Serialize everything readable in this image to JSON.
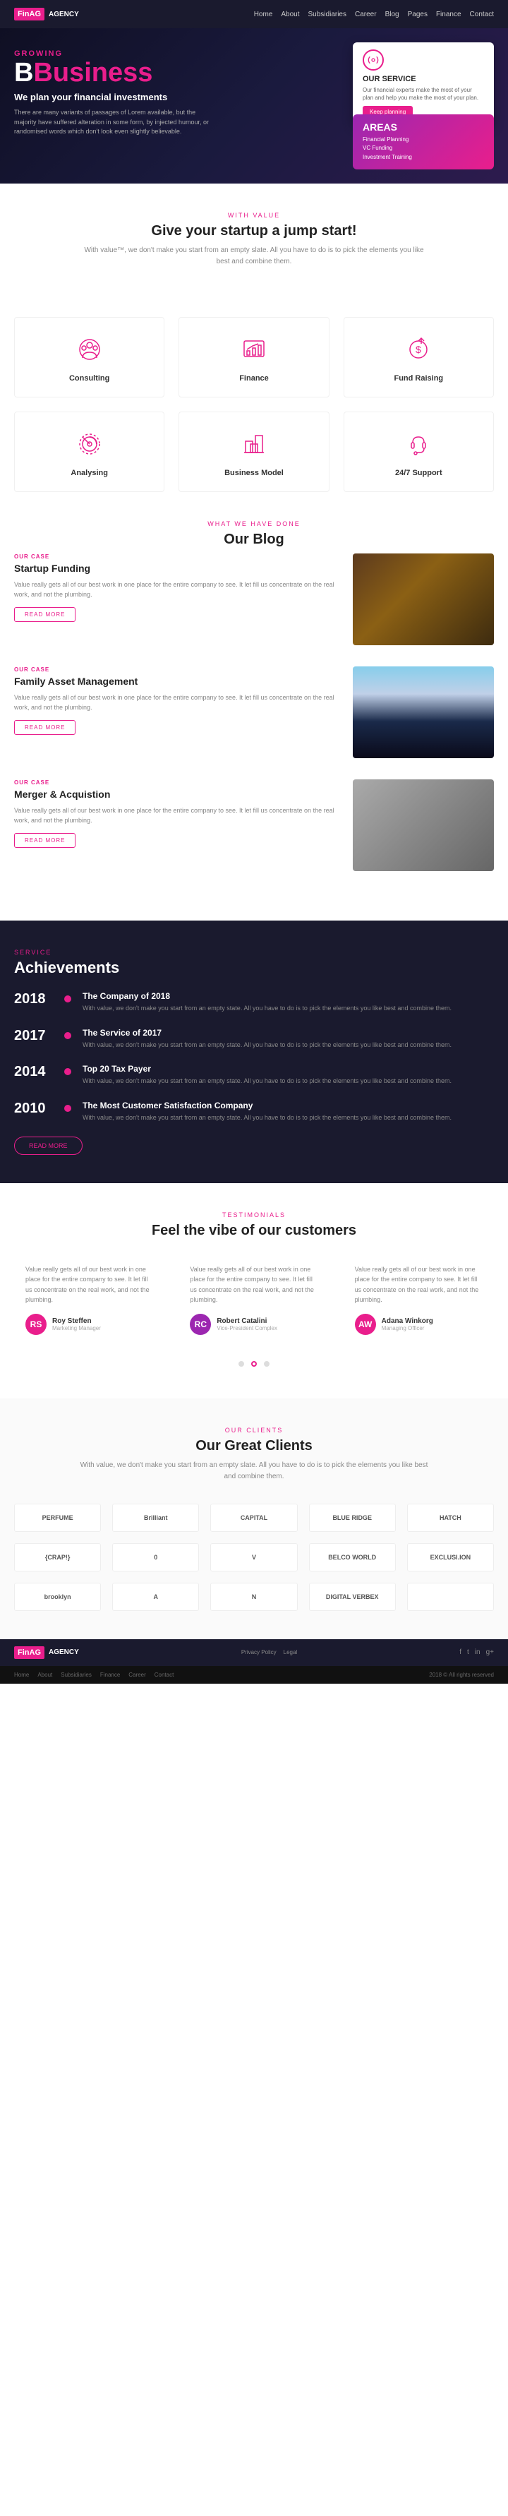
{
  "nav": {
    "logo": "FinAG",
    "logo_sub": "AGENCY",
    "links": [
      "Home",
      "About",
      "Subsidiaries",
      "Career",
      "Blog",
      "Pages",
      "Finance",
      "Contact"
    ]
  },
  "hero": {
    "label": "GROWING",
    "title": "Business",
    "title_color": "Business",
    "subtitle": "We plan your financial investments",
    "description": "There are many variants of passages of Lorem available, but the majority have suffered alteration in some form, by injected humour, or randomised words which don't look even slightly believable.",
    "service_card": {
      "title": "OUR SERVICE",
      "description": "Our financial experts make the most of your plan and help you make the most of your plan.",
      "button": "Keep planning"
    },
    "areas": {
      "title": "AREAS",
      "items": [
        "Financial Planning",
        "VC Funding",
        "Investment Training"
      ]
    }
  },
  "startup_section": {
    "label": "WITH VALUE",
    "title": "Give your startup a jump start!",
    "subtitle": "With value™, we don't make you start from an empty slate. All you have to do is to pick the elements you like best and combine them."
  },
  "services": [
    {
      "name": "Consulting",
      "icon": "globe-people"
    },
    {
      "name": "Finance",
      "icon": "chart-bar"
    },
    {
      "name": "Fund Raising",
      "icon": "coin-up"
    },
    {
      "name": "Analysing",
      "icon": "gear-chart"
    },
    {
      "name": "Business Model",
      "icon": "building-chart"
    },
    {
      "name": "24/7 Support",
      "icon": "support-bag"
    }
  ],
  "blog": {
    "label": "WHAT WE HAVE DONE",
    "title": "Our Blog",
    "items": [
      {
        "category": "OUR CASE",
        "title": "Startup Funding",
        "text": "Value really gets all of our best work in one place for the entire company to see. It let fill us concentrate on the real work, and not the plumbing.",
        "button": "READ MORE"
      },
      {
        "category": "OUR CASE",
        "title": "Family Asset Management",
        "text": "Value really gets all of our best work in one place for the entire company to see. It let fill us concentrate on the real work, and not the plumbing.",
        "button": "READ MORE"
      },
      {
        "category": "OUR CASE",
        "title": "Merger & Acquistion",
        "text": "Value really gets all of our best work in one place for the entire company to see. It let fill us concentrate on the real work, and not the plumbing.",
        "button": "READ MORE"
      }
    ]
  },
  "achievements": {
    "label": "SERVICE",
    "title": "Achievements",
    "items": [
      {
        "year": "2018",
        "name": "The Company of 2018",
        "desc": "With value, we don't make you start from an empty state. All you have to do is to pick the elements you like best and combine them."
      },
      {
        "year": "2017",
        "name": "The Service of 2017",
        "desc": "With value, we don't make you start from an empty state. All you have to do is to pick the elements you like best and combine them."
      },
      {
        "year": "2014",
        "name": "Top 20 Tax Payer",
        "desc": "With value, we don't make you start from an empty state. All you have to do is to pick the elements you like best and combine them."
      },
      {
        "year": "2010",
        "name": "The Most Customer Satisfaction Company",
        "desc": "With value, we don't make you start from an empty state. All you have to do is to pick the elements you like best and combine them."
      }
    ],
    "button": "READ MORE"
  },
  "testimonials": {
    "label": "TESTIMONIALS",
    "title": "Feel the vibe of our customers",
    "items": [
      {
        "text": "Value really gets all of our best work in one place for the entire company to see. It let fill us concentrate on the real work, and not the plumbing.",
        "name": "Roy Steffen",
        "role": "Marketing Manager",
        "avatar_color": "#e91e8c",
        "initials": "RS"
      },
      {
        "text": "Value really gets all of our best work in one place for the entire company to see. It let fill us concentrate on the real work, and not the plumbing.",
        "name": "Robert Catalini",
        "role": "Vice-President Complex",
        "avatar_color": "#9c27b0",
        "initials": "RC"
      },
      {
        "text": "Value really gets all of our best work in one place for the entire company to see. It let fill us concentrate on the real work, and not the plumbing.",
        "name": "Adana Winkorg",
        "role": "Managing Officer",
        "avatar_color": "#e91e8c",
        "initials": "AW"
      }
    ]
  },
  "clients": {
    "label": "OUR CLIENTS",
    "title": "Our Great Clients",
    "subtitle": "With value, we don't make you start from an empty slate. All you have to do is to pick the elements you like best and combine them.",
    "logos": [
      "PERFUME",
      "Brilliant",
      "CAPITAL",
      "BLUE RIDGE",
      "HATCH",
      "{CRAP!}",
      "0",
      "V",
      "BELCO WORLD",
      "EXCLUSI.ION",
      "brooklyn",
      "A",
      "N",
      "DIGITAL VERBEX",
      ""
    ]
  },
  "footer": {
    "logo": "FinAG",
    "logo_sub": "AGENCY",
    "links": [
      "Privacy Policy",
      "Legal"
    ],
    "social": [
      "f",
      "t",
      "in",
      "g+"
    ],
    "bottom_links": [
      "Home",
      "About",
      "Subsidiaries",
      "Finance",
      "Career",
      "Contact"
    ],
    "copyright": "2018 © All rights reserved"
  }
}
